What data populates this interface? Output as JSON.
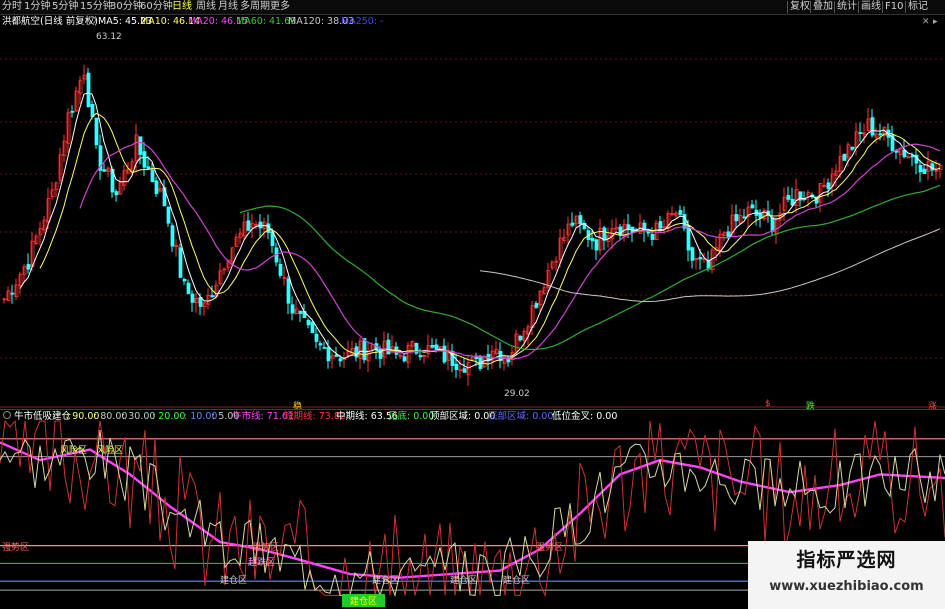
{
  "toolbar": {
    "left_items": [
      "分时",
      "1分钟",
      "5分钟",
      "15分钟",
      "30分钟",
      "60分钟",
      "日线",
      "周线",
      "月线",
      "多周期",
      "更多"
    ],
    "active_item": "日线",
    "right_items": [
      "复权",
      "叠加",
      "统计",
      "画线",
      "F10",
      "标记"
    ]
  },
  "main": {
    "stock_title": "洪都航空(日线 前复权)",
    "ma_items": [
      {
        "label": "MA5: 45.23",
        "color": "#ffffff"
      },
      {
        "label": "MA10: 46.14",
        "color": "#ffff66"
      },
      {
        "label": "MA20: 46.15",
        "color": "#ff44ff"
      },
      {
        "label": "MA60: 41.69",
        "color": "#33cc33"
      },
      {
        "label": "MA120: 38.03",
        "color": "#c8c8c8"
      },
      {
        "label": "MA250: -",
        "color": "#4444ff"
      }
    ],
    "high_label": "63.12",
    "low_label": "29.02",
    "signals": [
      {
        "text": "稳",
        "color": "#ffcc00"
      },
      {
        "text": "跌",
        "color": "#33ff33"
      },
      {
        "text": "涨",
        "color": "#ff4444"
      },
      {
        "text": "$",
        "color": "#ff4444"
      }
    ]
  },
  "sub": {
    "indicator_name": "牛市低吸建仓",
    "params": [
      {
        "text": ": 90.00",
        "color": "#ffff66"
      },
      {
        "text": ": 80.00",
        "color": "#c8c8c8"
      },
      {
        "text": ": 30.00",
        "color": "#c8c8c8"
      },
      {
        "text": ": 20.00",
        "color": "#33ff33"
      },
      {
        "text": ": 10.00",
        "color": "#6688ff"
      },
      {
        "text": ": 5.00",
        "color": "#c8c8c8"
      }
    ],
    "values": [
      {
        "text": "牛市线: 71.61",
        "color": "#ff44ff"
      },
      {
        "text": "短期线: 73.82",
        "color": "#ff3333"
      },
      {
        "text": "中期线: 63.56",
        "color": "#ffffff"
      },
      {
        "text": "见底: 0.00",
        "color": "#33ff33"
      },
      {
        "text": "顶部区域: 0.00",
        "color": "#ffffff"
      },
      {
        "text": "底部区域: 0.00",
        "color": "#6666ff"
      },
      {
        "text": "低位金叉: 0.00",
        "color": "#ffffff"
      }
    ],
    "zone_labels": {
      "risk1": "风险区",
      "risk2": "风险区",
      "strong": "强势区",
      "strong2": "强势区",
      "strong3": "强势区",
      "watch": "超跌区",
      "build": "建仓区",
      "build2": "建仓区",
      "build3": "建仓区",
      "build4": "建仓区",
      "bottom": "建仓区"
    }
  },
  "watermark": {
    "title": "指标严选网",
    "url": "www.xuezhibiao.com"
  },
  "colors": {
    "up_candle": "#ff3333",
    "down_candle": "#33ffff",
    "ma5": "#ffffff",
    "ma10": "#ffff66",
    "ma20": "#cc44cc",
    "ma60": "#33aa33",
    "ma120": "#c8c8c8",
    "grid": "#661111"
  }
}
